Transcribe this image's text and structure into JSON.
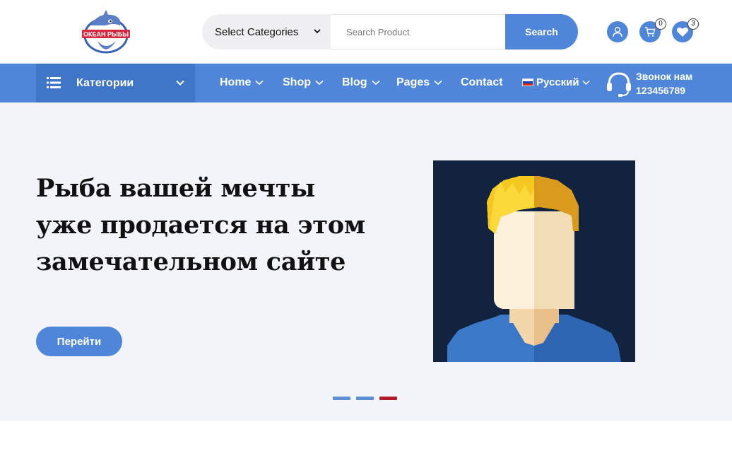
{
  "header": {
    "logo_text": "ОКЕАН РЫБЫ",
    "search": {
      "category_label": "Select Categories",
      "placeholder": "Search Product",
      "button_label": "Search"
    },
    "cart_count": "0",
    "wishlist_count": "3",
    "icons": [
      "user-icon",
      "cart-icon",
      "heart-icon"
    ]
  },
  "nav": {
    "categories_label": "Категории",
    "items": [
      {
        "label": "Home",
        "has_dropdown": true
      },
      {
        "label": "Shop",
        "has_dropdown": true
      },
      {
        "label": "Blog",
        "has_dropdown": true
      },
      {
        "label": "Pages",
        "has_dropdown": true
      },
      {
        "label": "Contact",
        "has_dropdown": false
      }
    ],
    "language": "Русский",
    "call": {
      "label": "Звонок нам",
      "phone": "123456789"
    }
  },
  "hero": {
    "title": "Рыба вашей мечты уже продается на этом замечательном сайте",
    "button_label": "Перейти",
    "slides_count": 3,
    "active_slide": 3
  },
  "colors": {
    "accent": "#4f86d9",
    "accent_dark": "#3f76c8",
    "hero_bg": "#f2f4f9",
    "active_dot": "#b31b2a"
  }
}
